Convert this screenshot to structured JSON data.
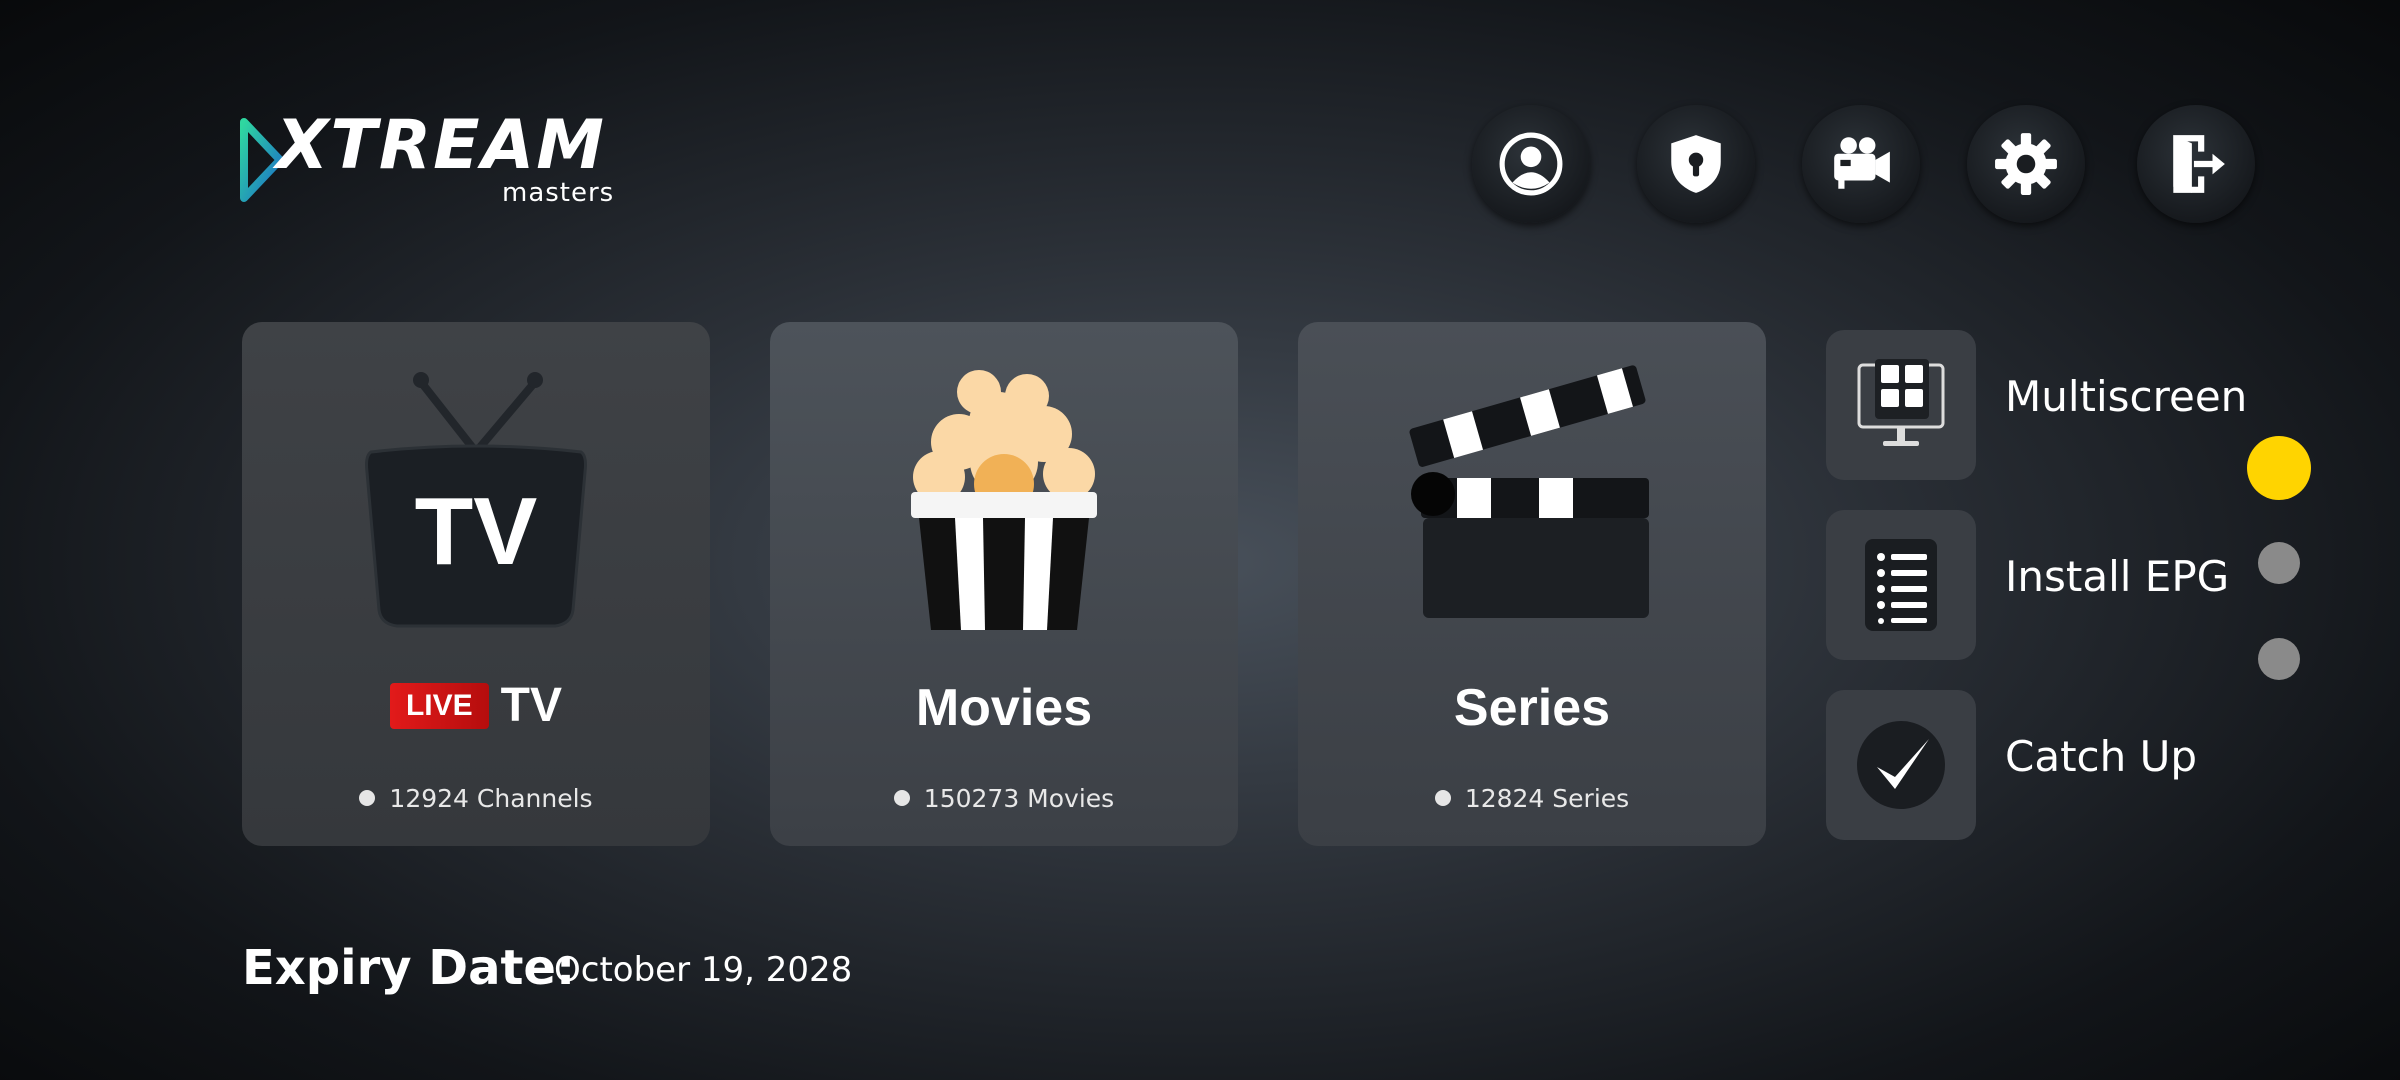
{
  "logo": {
    "title": "XTREAM",
    "subtitle": "masters"
  },
  "top_icons": [
    "user-icon",
    "shield-lock-icon",
    "video-camera-icon",
    "gear-icon",
    "logout-icon"
  ],
  "cards": {
    "live": {
      "badge": "LIVE",
      "title": "TV",
      "count": "12924 Channels"
    },
    "movies": {
      "title": "Movies",
      "count": "150273 Movies"
    },
    "series": {
      "title": "Series",
      "count": "12824 Series"
    }
  },
  "side_menu": [
    {
      "label": "Multiscreen",
      "icon": "multiscreen-icon"
    },
    {
      "label": "Install EPG",
      "icon": "epg-list-icon"
    },
    {
      "label": "Catch Up",
      "icon": "checkmark-icon"
    }
  ],
  "page_indicator": {
    "active_index": 0,
    "count": 3,
    "active_color": "#ffd400",
    "inactive_color": "#8a8a8a"
  },
  "expiry": {
    "label": "Expiry Date:",
    "value": "October 19, 2028"
  }
}
